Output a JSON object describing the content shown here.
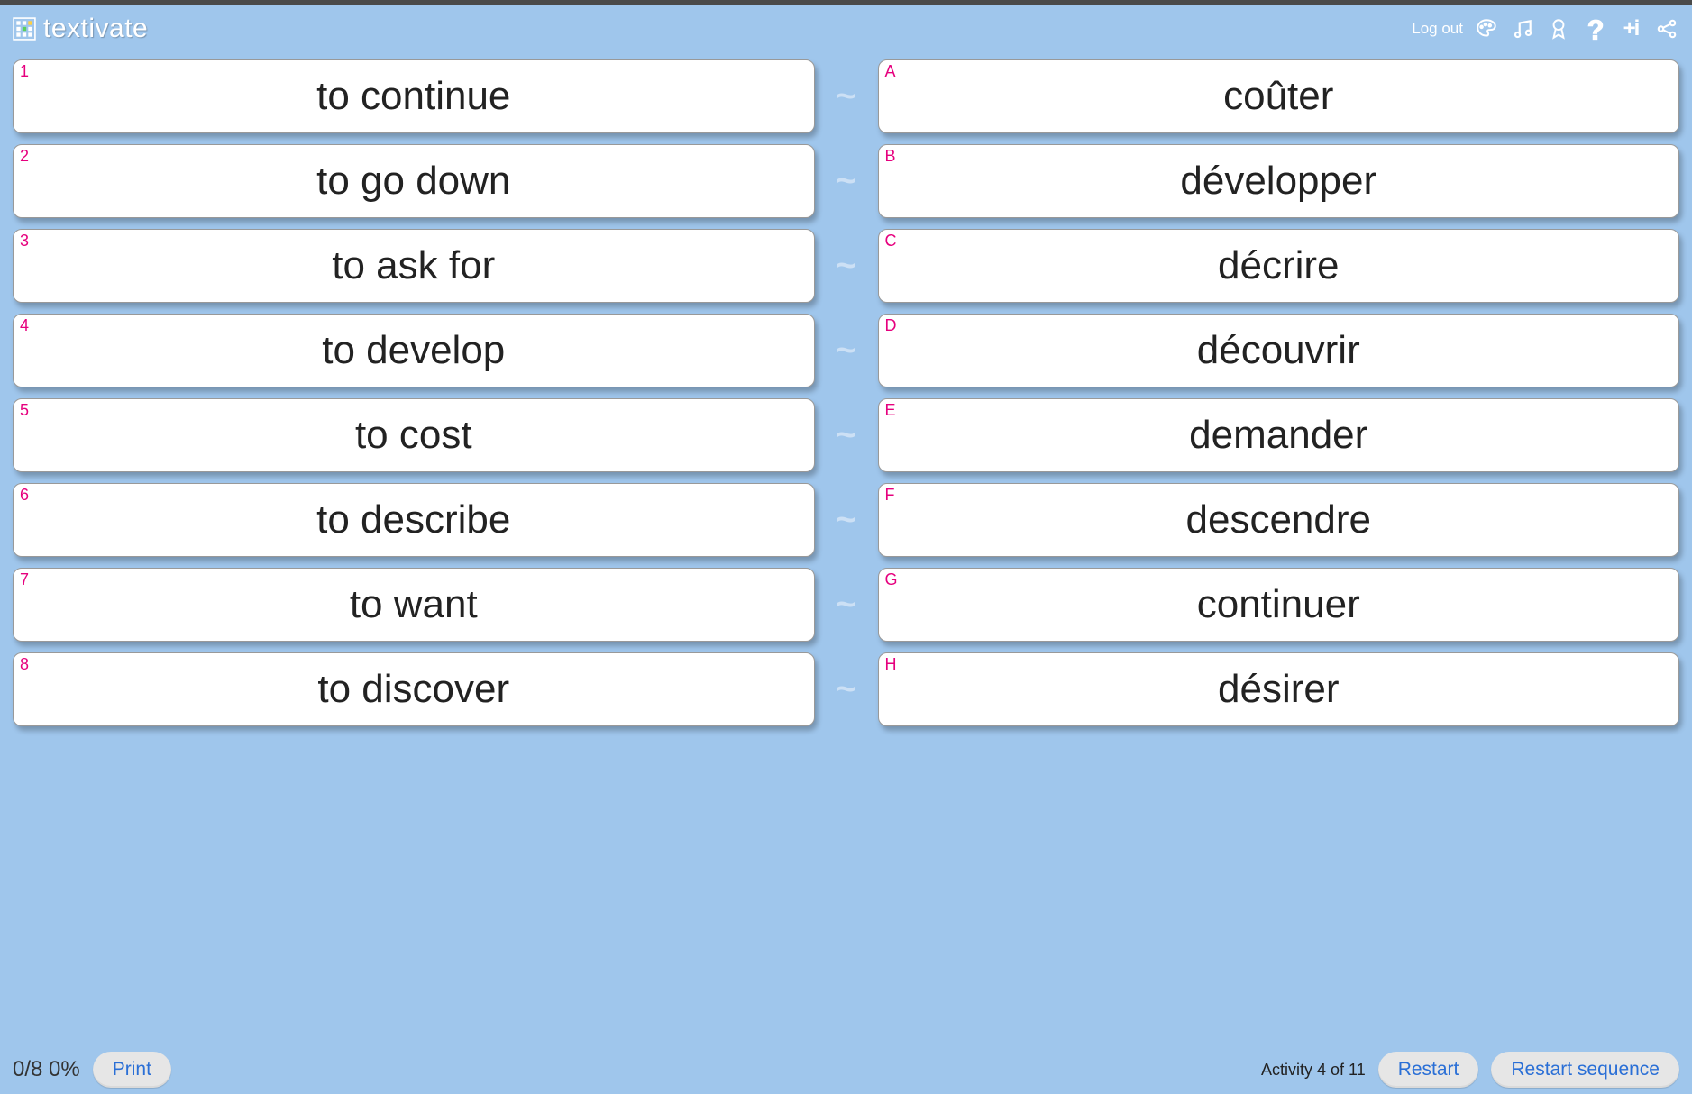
{
  "header": {
    "brand": "textivate",
    "logout": "Log out"
  },
  "left_items": [
    {
      "label": "1",
      "text": "to continue"
    },
    {
      "label": "2",
      "text": "to go down"
    },
    {
      "label": "3",
      "text": "to ask for"
    },
    {
      "label": "4",
      "text": "to develop"
    },
    {
      "label": "5",
      "text": "to cost"
    },
    {
      "label": "6",
      "text": "to describe"
    },
    {
      "label": "7",
      "text": "to want"
    },
    {
      "label": "8",
      "text": "to discover"
    }
  ],
  "right_items": [
    {
      "label": "A",
      "text": "coûter"
    },
    {
      "label": "B",
      "text": "développer"
    },
    {
      "label": "C",
      "text": "décrire"
    },
    {
      "label": "D",
      "text": "découvrir"
    },
    {
      "label": "E",
      "text": "demander"
    },
    {
      "label": "F",
      "text": "descendre"
    },
    {
      "label": "G",
      "text": "continuer"
    },
    {
      "label": "H",
      "text": "désirer"
    }
  ],
  "footer": {
    "score": "0/8 0%",
    "print": "Print",
    "activity": "Activity 4 of 11",
    "restart": "Restart",
    "restart_seq": "Restart sequence"
  },
  "tilde": "~"
}
